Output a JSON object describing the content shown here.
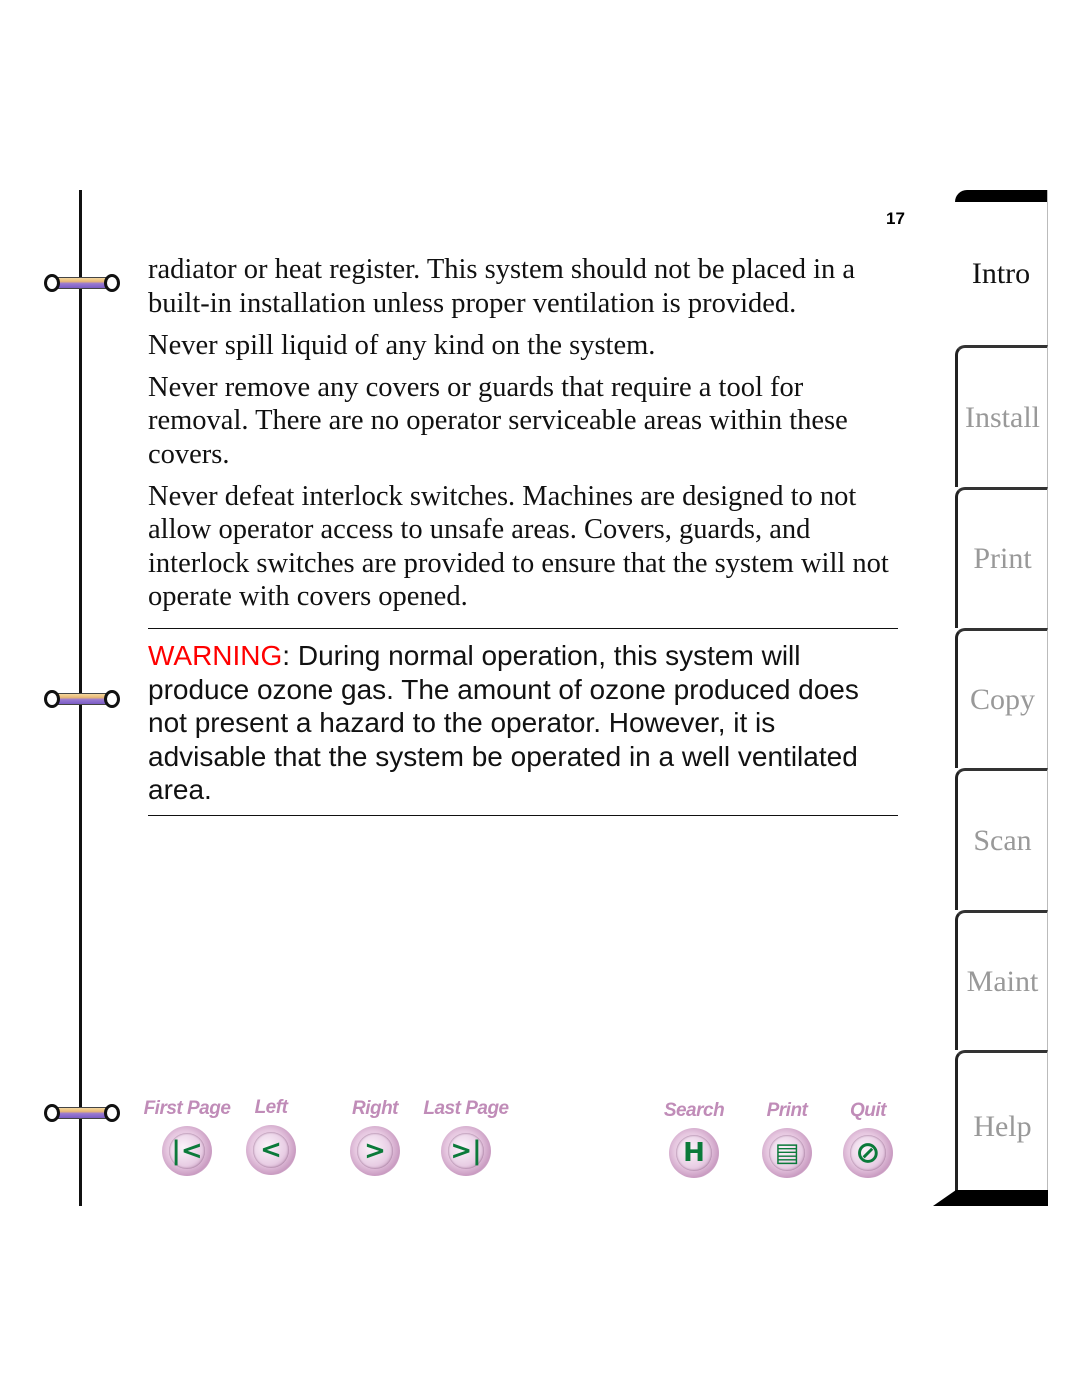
{
  "page": {
    "number": "17",
    "paragraphs": [
      "radiator or heat register. This system should not be placed in a built-in installation unless proper ventilation is provided.",
      "Never spill liquid of any kind on the system.",
      "Never remove any covers or guards that require a tool for removal. There are no operator serviceable areas within these covers.",
      "Never defeat interlock switches. Machines are designed to not allow operator access to unsafe areas. Covers, guards, and interlock switches are provided to ensure that the system will not operate with covers opened."
    ],
    "warning": {
      "label": "WARNING",
      "text": ": During normal operation, this system will produce ozone gas. The amount of ozone produced does not present a hazard to the operator. However, it is advisable that the system be operated in a well ventilated area.",
      "label_color": "#ff0000"
    }
  },
  "tabs": [
    {
      "label": "Intro",
      "active": true
    },
    {
      "label": "Install",
      "active": false
    },
    {
      "label": "Print",
      "active": false
    },
    {
      "label": "Copy",
      "active": false
    },
    {
      "label": "Scan",
      "active": false
    },
    {
      "label": "Maint",
      "active": false
    },
    {
      "label": "Help",
      "active": false
    }
  ],
  "nav": {
    "first_page": {
      "label": "First Page",
      "icon": "first-page-icon",
      "glyph": "|<"
    },
    "left": {
      "label": "Left",
      "icon": "left-arrow-icon",
      "glyph": "<"
    },
    "right": {
      "label": "Right",
      "icon": "right-arrow-icon",
      "glyph": ">"
    },
    "last_page": {
      "label": "Last Page",
      "icon": "last-page-icon",
      "glyph": ">|"
    },
    "search": {
      "label": "Search",
      "icon": "binoculars-icon",
      "glyph": "H"
    },
    "print": {
      "label": "Print",
      "icon": "document-icon",
      "glyph": "▤"
    },
    "quit": {
      "label": "Quit",
      "icon": "no-entry-icon",
      "glyph": "⃠"
    }
  },
  "colors": {
    "nav_label": "#c08cb8",
    "nav_glyph": "#0b7a3a",
    "tab_inactive_text": "#999999"
  }
}
